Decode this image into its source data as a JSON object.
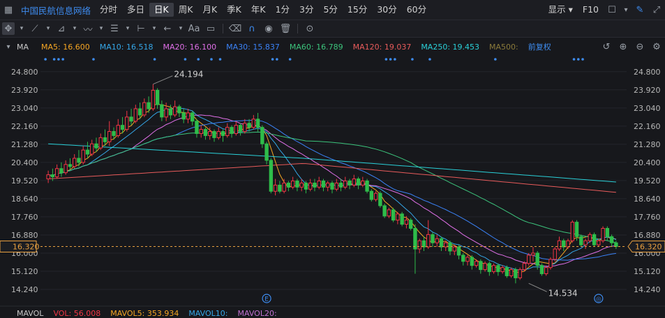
{
  "topbar": {
    "title": "中国民航信息网络",
    "tabs": [
      "分时",
      "多日",
      "日K",
      "周K",
      "月K",
      "季K",
      "年K",
      "1分",
      "3分",
      "5分",
      "15分",
      "30分",
      "60分"
    ],
    "active_tab": "日K",
    "right": {
      "display_label": "显示",
      "f10_label": "F10"
    }
  },
  "toolbar": {
    "text_tool": "Aa"
  },
  "ma_bar": {
    "label": "MA",
    "items": [
      {
        "text": "MA5: 16.600",
        "color": "#f5a623"
      },
      {
        "text": "MA10: 16.518",
        "color": "#35a7e8"
      },
      {
        "text": "MA20: 16.100",
        "color": "#e070e8"
      },
      {
        "text": "MA30: 15.837",
        "color": "#3b82f6"
      },
      {
        "text": "MA60: 16.789",
        "color": "#3cc47c"
      },
      {
        "text": "MA120: 19.037",
        "color": "#e85b5b"
      },
      {
        "text": "MA250: 19.453",
        "color": "#2ad0d8"
      },
      {
        "text": "MA500:",
        "color": "#8a7a3a"
      }
    ],
    "adjust_label": "前复权"
  },
  "chart_data": {
    "type": "candlestick",
    "ylim": [
      13.8,
      25.3
    ],
    "y_ticks": [
      24.8,
      23.92,
      23.04,
      22.16,
      21.28,
      20.4,
      19.52,
      18.64,
      17.76,
      16.88,
      16.0,
      15.12,
      14.24
    ],
    "y_tick_labels": [
      "24.800",
      "23.920",
      "23.040",
      "22.160",
      "21.280",
      "20.400",
      "19.520",
      "18.640",
      "17.760",
      "16.880",
      "16.000",
      "15.120",
      "14.240"
    ],
    "current_price": 16.32,
    "current_price_label": "16.320",
    "annotations": {
      "high": {
        "value": 24.194,
        "label": "24.194",
        "index": 24
      },
      "low": {
        "value": 14.534,
        "label": "14.534",
        "index": 110
      }
    },
    "event_markers": [
      {
        "index": 50,
        "label": "E"
      },
      {
        "index": 126,
        "label": "◎"
      }
    ],
    "up_color": "#f23645",
    "down_color": "#2ebd4a",
    "candles": [
      [
        19.6,
        19.8,
        19.4,
        20.0
      ],
      [
        19.8,
        19.7,
        19.5,
        20.1
      ],
      [
        19.7,
        20.1,
        19.6,
        20.3
      ],
      [
        20.1,
        19.9,
        19.7,
        20.4
      ],
      [
        19.9,
        20.3,
        19.8,
        20.5
      ],
      [
        20.3,
        20.2,
        20.0,
        20.6
      ],
      [
        20.2,
        20.6,
        20.1,
        20.8
      ],
      [
        20.6,
        20.4,
        20.2,
        21.0
      ],
      [
        20.4,
        21.0,
        20.3,
        21.2
      ],
      [
        21.0,
        20.8,
        20.6,
        21.4
      ],
      [
        20.8,
        21.3,
        20.7,
        21.5
      ],
      [
        21.3,
        21.1,
        20.9,
        21.6
      ],
      [
        21.1,
        21.6,
        21.0,
        21.8
      ],
      [
        21.6,
        21.4,
        21.2,
        22.0
      ],
      [
        21.4,
        21.9,
        21.2,
        22.4
      ],
      [
        21.9,
        21.7,
        21.5,
        22.1
      ],
      [
        21.7,
        22.2,
        21.6,
        22.5
      ],
      [
        22.2,
        22.0,
        21.8,
        22.6
      ],
      [
        22.0,
        22.6,
        21.9,
        22.9
      ],
      [
        22.6,
        22.4,
        22.2,
        23.0
      ],
      [
        22.4,
        23.0,
        22.3,
        23.2
      ],
      [
        23.0,
        22.7,
        22.5,
        23.3
      ],
      [
        22.7,
        23.3,
        22.6,
        23.5
      ],
      [
        23.3,
        23.0,
        22.8,
        23.6
      ],
      [
        23.0,
        23.9,
        22.9,
        24.19
      ],
      [
        23.9,
        23.2,
        23.0,
        24.0
      ],
      [
        23.2,
        22.6,
        22.4,
        23.4
      ],
      [
        22.6,
        23.0,
        22.4,
        23.3
      ],
      [
        23.0,
        22.7,
        22.5,
        23.2
      ],
      [
        22.7,
        23.1,
        22.6,
        23.4
      ],
      [
        23.1,
        22.8,
        22.6,
        23.2
      ],
      [
        22.8,
        22.5,
        22.3,
        23.0
      ],
      [
        22.5,
        22.8,
        22.3,
        23.0
      ],
      [
        22.8,
        22.4,
        22.2,
        22.9
      ],
      [
        22.4,
        21.8,
        21.6,
        22.5
      ],
      [
        21.8,
        22.0,
        21.6,
        22.2
      ],
      [
        22.0,
        21.7,
        21.5,
        22.1
      ],
      [
        21.7,
        21.9,
        21.5,
        22.1
      ],
      [
        21.9,
        21.6,
        21.4,
        22.0
      ],
      [
        21.6,
        21.9,
        21.5,
        22.1
      ],
      [
        21.9,
        21.7,
        21.4,
        22.0
      ],
      [
        21.7,
        22.1,
        21.6,
        22.3
      ],
      [
        22.1,
        21.8,
        21.6,
        22.2
      ],
      [
        21.8,
        22.2,
        21.7,
        22.4
      ],
      [
        22.2,
        21.9,
        21.7,
        22.3
      ],
      [
        21.9,
        22.3,
        21.8,
        22.5
      ],
      [
        22.3,
        22.1,
        21.9,
        22.5
      ],
      [
        22.1,
        22.5,
        22.0,
        22.7
      ],
      [
        22.5,
        22.1,
        21.9,
        22.8
      ],
      [
        22.1,
        21.3,
        21.1,
        22.2
      ],
      [
        21.3,
        20.5,
        20.3,
        21.4
      ],
      [
        20.5,
        19.0,
        18.9,
        20.6
      ],
      [
        19.0,
        19.3,
        18.8,
        19.6
      ],
      [
        19.3,
        19.0,
        18.9,
        19.5
      ],
      [
        19.0,
        19.4,
        18.9,
        19.6
      ],
      [
        19.4,
        19.2,
        19.0,
        19.5
      ],
      [
        19.2,
        19.5,
        19.1,
        19.7
      ],
      [
        19.5,
        19.2,
        19.0,
        19.6
      ],
      [
        19.2,
        19.4,
        19.0,
        19.6
      ],
      [
        19.4,
        19.1,
        18.9,
        19.5
      ],
      [
        19.1,
        19.4,
        19.0,
        19.6
      ],
      [
        19.4,
        19.2,
        19.0,
        19.6
      ],
      [
        19.2,
        19.5,
        19.1,
        19.7
      ],
      [
        19.5,
        19.2,
        19.0,
        19.6
      ],
      [
        19.2,
        19.4,
        19.0,
        19.5
      ],
      [
        19.4,
        19.1,
        18.9,
        19.5
      ],
      [
        19.1,
        19.4,
        19.0,
        19.6
      ],
      [
        19.4,
        19.2,
        19.0,
        19.6
      ],
      [
        19.2,
        19.5,
        19.1,
        19.7
      ],
      [
        19.5,
        19.3,
        19.1,
        19.6
      ],
      [
        19.3,
        19.6,
        19.2,
        19.8
      ],
      [
        19.6,
        19.3,
        19.1,
        19.7
      ],
      [
        19.3,
        19.5,
        19.2,
        19.7
      ],
      [
        19.5,
        19.0,
        18.9,
        19.6
      ],
      [
        19.0,
        18.6,
        18.5,
        19.1
      ],
      [
        18.6,
        18.9,
        18.5,
        19.0
      ],
      [
        18.9,
        18.3,
        18.2,
        19.0
      ],
      [
        18.3,
        17.8,
        17.7,
        18.4
      ],
      [
        17.8,
        18.1,
        17.7,
        18.2
      ],
      [
        18.1,
        17.6,
        17.5,
        18.2
      ],
      [
        17.6,
        17.9,
        17.4,
        18.0
      ],
      [
        17.9,
        17.4,
        17.3,
        18.0
      ],
      [
        17.4,
        17.6,
        17.2,
        17.8
      ],
      [
        17.6,
        17.2,
        17.1,
        17.7
      ],
      [
        17.2,
        16.2,
        15.0,
        17.4
      ],
      [
        16.2,
        16.6,
        16.0,
        16.7
      ],
      [
        16.6,
        16.3,
        16.1,
        16.8
      ],
      [
        16.3,
        16.9,
        16.2,
        17.6
      ],
      [
        16.9,
        16.5,
        16.3,
        17.0
      ],
      [
        16.5,
        16.7,
        16.3,
        16.9
      ],
      [
        16.7,
        16.3,
        16.1,
        16.8
      ],
      [
        16.3,
        16.5,
        16.1,
        16.6
      ],
      [
        16.5,
        16.1,
        15.9,
        16.6
      ],
      [
        16.1,
        16.3,
        15.9,
        16.4
      ],
      [
        16.3,
        15.9,
        15.7,
        16.4
      ],
      [
        15.9,
        15.6,
        15.4,
        16.0
      ],
      [
        15.6,
        15.8,
        15.4,
        15.9
      ],
      [
        15.8,
        15.4,
        15.2,
        15.9
      ],
      [
        15.4,
        15.6,
        15.3,
        15.7
      ],
      [
        15.6,
        15.2,
        15.0,
        15.7
      ],
      [
        15.2,
        15.5,
        15.1,
        15.6
      ],
      [
        15.5,
        15.1,
        14.9,
        15.6
      ],
      [
        15.1,
        15.4,
        15.0,
        15.5
      ],
      [
        15.4,
        15.1,
        14.9,
        15.5
      ],
      [
        15.1,
        15.3,
        15.0,
        15.4
      ],
      [
        15.3,
        14.9,
        14.8,
        15.4
      ],
      [
        14.9,
        15.2,
        14.8,
        15.3
      ],
      [
        15.2,
        14.8,
        14.534,
        15.3
      ],
      [
        14.8,
        15.2,
        14.7,
        15.3
      ],
      [
        15.2,
        15.5,
        15.1,
        15.6
      ],
      [
        15.5,
        15.9,
        15.4,
        16.0
      ],
      [
        15.9,
        16.0,
        15.6,
        16.3
      ],
      [
        16.0,
        15.4,
        15.2,
        16.1
      ],
      [
        15.4,
        15.0,
        14.9,
        15.5
      ],
      [
        15.0,
        15.3,
        14.9,
        15.4
      ],
      [
        15.3,
        15.7,
        15.2,
        15.8
      ],
      [
        15.7,
        16.2,
        15.6,
        16.3
      ],
      [
        16.2,
        16.6,
        16.1,
        16.8
      ],
      [
        16.6,
        16.3,
        16.1,
        16.7
      ],
      [
        16.3,
        16.6,
        16.2,
        16.7
      ],
      [
        16.6,
        17.5,
        16.5,
        17.6
      ],
      [
        17.5,
        16.8,
        16.6,
        17.6
      ],
      [
        16.8,
        16.4,
        16.3,
        16.9
      ],
      [
        16.4,
        16.6,
        16.2,
        16.7
      ],
      [
        16.6,
        16.9,
        16.5,
        17.0
      ],
      [
        16.9,
        16.4,
        16.3,
        17.0
      ],
      [
        16.4,
        16.6,
        16.3,
        16.7
      ],
      [
        16.6,
        17.2,
        16.5,
        17.3
      ],
      [
        17.2,
        16.8,
        16.6,
        17.3
      ],
      [
        16.8,
        16.5,
        16.3,
        16.9
      ],
      [
        16.5,
        16.32,
        16.2,
        16.6
      ]
    ]
  },
  "vol_bar": {
    "items": [
      {
        "text": "MAVOL",
        "color": "#c8c8c8"
      },
      {
        "text": "VOL: 56.008",
        "color": "#f23645"
      },
      {
        "text": "MAVOL5: 353.934",
        "color": "#f5a623"
      },
      {
        "text": "MAVOL10:",
        "color": "#35a7e8"
      },
      {
        "text": "MAVOL20:",
        "color": "#c070d0"
      }
    ]
  }
}
